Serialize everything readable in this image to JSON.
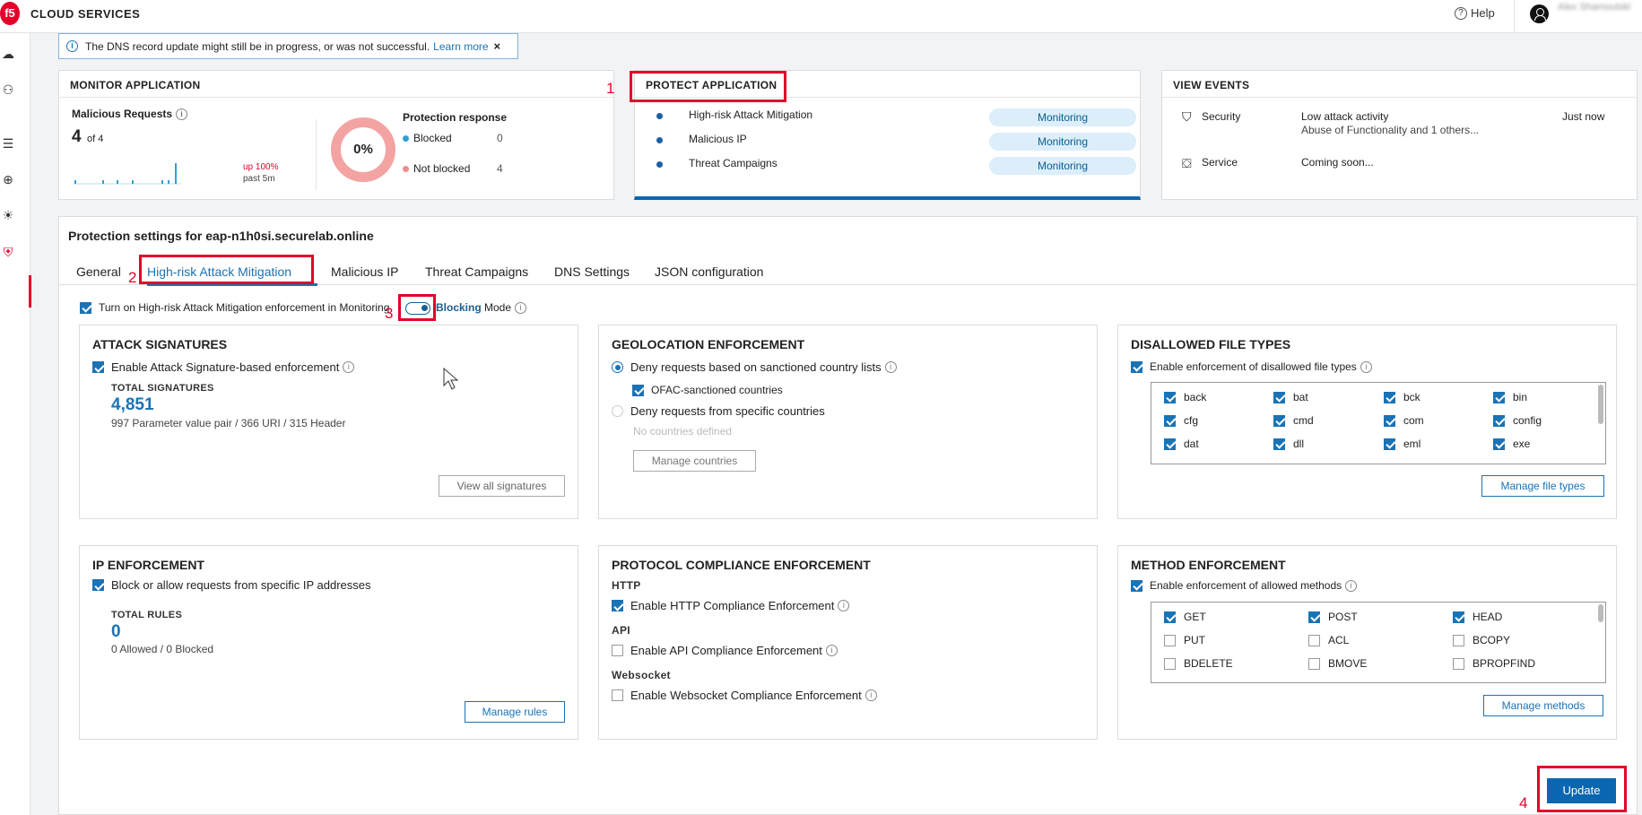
{
  "app": {
    "logo": "f5",
    "title": "CLOUD SERVICES",
    "help": "Help",
    "username": "Alex Shamoulski"
  },
  "banner": {
    "text": "The DNS record update might still be in progress, or was not successful.",
    "link": "Learn more",
    "close": "×"
  },
  "monitor": {
    "title": "MONITOR APPLICATION",
    "malicious_label": "Malicious Requests",
    "count": "4",
    "of": "of 4",
    "trend": "up 100%",
    "period": "past 5m",
    "donut_pct": "0%",
    "response_title": "Protection response",
    "blocked_label": "Blocked",
    "blocked_value": "0",
    "notblocked_label": "Not blocked",
    "notblocked_value": "4",
    "colors": {
      "blocked": "#2e9fd8",
      "not_blocked": "#f08c8c"
    }
  },
  "protect": {
    "title": "PROTECT APPLICATION",
    "items": [
      {
        "name": "High-risk Attack Mitigation",
        "status": "Monitoring"
      },
      {
        "name": "Malicious IP",
        "status": "Monitoring"
      },
      {
        "name": "Threat Campaigns",
        "status": "Monitoring"
      }
    ]
  },
  "events": {
    "title": "VIEW EVENTS",
    "security_label": "Security",
    "security_text": "Low attack activity",
    "security_sub": "Abuse of Functionality and 1 others...",
    "security_time": "Just now",
    "service_label": "Service",
    "service_text": "Coming soon..."
  },
  "settings": {
    "title": "Protection settings for eap-n1h0si.securelab.online",
    "tabs": [
      "General",
      "High-risk Attack Mitigation",
      "Malicious IP",
      "Threat Campaigns",
      "DNS Settings",
      "JSON configuration"
    ],
    "enforcement_text": "Turn on High-risk Attack Mitigation enforcement in Monitoring",
    "blocking": "Blocking",
    "mode": "Mode"
  },
  "attack_signatures": {
    "title": "ATTACK SIGNATURES",
    "checkbox": "Enable Attack Signature-based enforcement",
    "total_label": "TOTAL SIGNATURES",
    "total": "4,851",
    "breakdown": "997 Parameter value pair / 366 URI / 315 Header",
    "button": "View all signatures"
  },
  "geolocation": {
    "title": "GEOLOCATION ENFORCEMENT",
    "radio1": "Deny requests based on sanctioned country lists",
    "ofac": "OFAC-sanctioned countries",
    "radio2": "Deny requests from specific countries",
    "none": "No countries defined",
    "button": "Manage countries"
  },
  "file_types": {
    "title": "DISALLOWED FILE TYPES",
    "checkbox": "Enable enforcement of disallowed file types",
    "items": [
      "back",
      "bat",
      "bck",
      "bin",
      "cfg",
      "cmd",
      "com",
      "config",
      "dat",
      "dll",
      "eml",
      "exe"
    ],
    "button": "Manage file types"
  },
  "ip": {
    "title": "IP ENFORCEMENT",
    "checkbox": "Block or allow requests from specific IP addresses",
    "total_label": "TOTAL RULES",
    "total": "0",
    "breakdown": "0 Allowed / 0 Blocked",
    "button": "Manage rules"
  },
  "protocol": {
    "title": "PROTOCOL COMPLIANCE ENFORCEMENT",
    "http_label": "HTTP",
    "http_cb": "Enable HTTP Compliance Enforcement",
    "api_label": "API",
    "api_cb": "Enable API Compliance Enforcement",
    "ws_label": "Websocket",
    "ws_cb": "Enable Websocket Compliance Enforcement"
  },
  "methods": {
    "title": "METHOD ENFORCEMENT",
    "checkbox": "Enable enforcement of allowed methods",
    "items": [
      {
        "name": "GET",
        "checked": true
      },
      {
        "name": "POST",
        "checked": true
      },
      {
        "name": "HEAD",
        "checked": true
      },
      {
        "name": "PUT",
        "checked": false
      },
      {
        "name": "ACL",
        "checked": false
      },
      {
        "name": "BCOPY",
        "checked": false
      },
      {
        "name": "BDELETE",
        "checked": false
      },
      {
        "name": "BMOVE",
        "checked": false
      },
      {
        "name": "BPROPFIND",
        "checked": false
      }
    ],
    "button": "Manage methods"
  },
  "update_button": "Update",
  "annotations": [
    "1",
    "2",
    "3",
    "4"
  ]
}
